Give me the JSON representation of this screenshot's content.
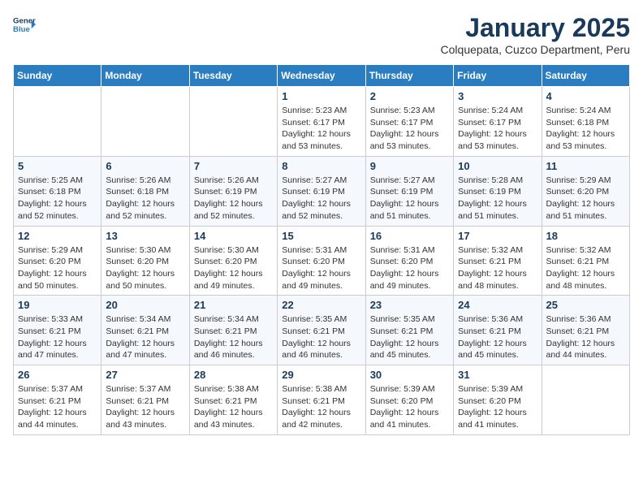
{
  "logo": {
    "line1": "General",
    "line2": "Blue"
  },
  "title": "January 2025",
  "subtitle": "Colquepata, Cuzco Department, Peru",
  "days_of_week": [
    "Sunday",
    "Monday",
    "Tuesday",
    "Wednesday",
    "Thursday",
    "Friday",
    "Saturday"
  ],
  "weeks": [
    [
      {
        "day": "",
        "info": ""
      },
      {
        "day": "",
        "info": ""
      },
      {
        "day": "",
        "info": ""
      },
      {
        "day": "1",
        "info": "Sunrise: 5:23 AM\nSunset: 6:17 PM\nDaylight: 12 hours\nand 53 minutes."
      },
      {
        "day": "2",
        "info": "Sunrise: 5:23 AM\nSunset: 6:17 PM\nDaylight: 12 hours\nand 53 minutes."
      },
      {
        "day": "3",
        "info": "Sunrise: 5:24 AM\nSunset: 6:17 PM\nDaylight: 12 hours\nand 53 minutes."
      },
      {
        "day": "4",
        "info": "Sunrise: 5:24 AM\nSunset: 6:18 PM\nDaylight: 12 hours\nand 53 minutes."
      }
    ],
    [
      {
        "day": "5",
        "info": "Sunrise: 5:25 AM\nSunset: 6:18 PM\nDaylight: 12 hours\nand 52 minutes."
      },
      {
        "day": "6",
        "info": "Sunrise: 5:26 AM\nSunset: 6:18 PM\nDaylight: 12 hours\nand 52 minutes."
      },
      {
        "day": "7",
        "info": "Sunrise: 5:26 AM\nSunset: 6:19 PM\nDaylight: 12 hours\nand 52 minutes."
      },
      {
        "day": "8",
        "info": "Sunrise: 5:27 AM\nSunset: 6:19 PM\nDaylight: 12 hours\nand 52 minutes."
      },
      {
        "day": "9",
        "info": "Sunrise: 5:27 AM\nSunset: 6:19 PM\nDaylight: 12 hours\nand 51 minutes."
      },
      {
        "day": "10",
        "info": "Sunrise: 5:28 AM\nSunset: 6:19 PM\nDaylight: 12 hours\nand 51 minutes."
      },
      {
        "day": "11",
        "info": "Sunrise: 5:29 AM\nSunset: 6:20 PM\nDaylight: 12 hours\nand 51 minutes."
      }
    ],
    [
      {
        "day": "12",
        "info": "Sunrise: 5:29 AM\nSunset: 6:20 PM\nDaylight: 12 hours\nand 50 minutes."
      },
      {
        "day": "13",
        "info": "Sunrise: 5:30 AM\nSunset: 6:20 PM\nDaylight: 12 hours\nand 50 minutes."
      },
      {
        "day": "14",
        "info": "Sunrise: 5:30 AM\nSunset: 6:20 PM\nDaylight: 12 hours\nand 49 minutes."
      },
      {
        "day": "15",
        "info": "Sunrise: 5:31 AM\nSunset: 6:20 PM\nDaylight: 12 hours\nand 49 minutes."
      },
      {
        "day": "16",
        "info": "Sunrise: 5:31 AM\nSunset: 6:20 PM\nDaylight: 12 hours\nand 49 minutes."
      },
      {
        "day": "17",
        "info": "Sunrise: 5:32 AM\nSunset: 6:21 PM\nDaylight: 12 hours\nand 48 minutes."
      },
      {
        "day": "18",
        "info": "Sunrise: 5:32 AM\nSunset: 6:21 PM\nDaylight: 12 hours\nand 48 minutes."
      }
    ],
    [
      {
        "day": "19",
        "info": "Sunrise: 5:33 AM\nSunset: 6:21 PM\nDaylight: 12 hours\nand 47 minutes."
      },
      {
        "day": "20",
        "info": "Sunrise: 5:34 AM\nSunset: 6:21 PM\nDaylight: 12 hours\nand 47 minutes."
      },
      {
        "day": "21",
        "info": "Sunrise: 5:34 AM\nSunset: 6:21 PM\nDaylight: 12 hours\nand 46 minutes."
      },
      {
        "day": "22",
        "info": "Sunrise: 5:35 AM\nSunset: 6:21 PM\nDaylight: 12 hours\nand 46 minutes."
      },
      {
        "day": "23",
        "info": "Sunrise: 5:35 AM\nSunset: 6:21 PM\nDaylight: 12 hours\nand 45 minutes."
      },
      {
        "day": "24",
        "info": "Sunrise: 5:36 AM\nSunset: 6:21 PM\nDaylight: 12 hours\nand 45 minutes."
      },
      {
        "day": "25",
        "info": "Sunrise: 5:36 AM\nSunset: 6:21 PM\nDaylight: 12 hours\nand 44 minutes."
      }
    ],
    [
      {
        "day": "26",
        "info": "Sunrise: 5:37 AM\nSunset: 6:21 PM\nDaylight: 12 hours\nand 44 minutes."
      },
      {
        "day": "27",
        "info": "Sunrise: 5:37 AM\nSunset: 6:21 PM\nDaylight: 12 hours\nand 43 minutes."
      },
      {
        "day": "28",
        "info": "Sunrise: 5:38 AM\nSunset: 6:21 PM\nDaylight: 12 hours\nand 43 minutes."
      },
      {
        "day": "29",
        "info": "Sunrise: 5:38 AM\nSunset: 6:21 PM\nDaylight: 12 hours\nand 42 minutes."
      },
      {
        "day": "30",
        "info": "Sunrise: 5:39 AM\nSunset: 6:20 PM\nDaylight: 12 hours\nand 41 minutes."
      },
      {
        "day": "31",
        "info": "Sunrise: 5:39 AM\nSunset: 6:20 PM\nDaylight: 12 hours\nand 41 minutes."
      },
      {
        "day": "",
        "info": ""
      }
    ]
  ]
}
